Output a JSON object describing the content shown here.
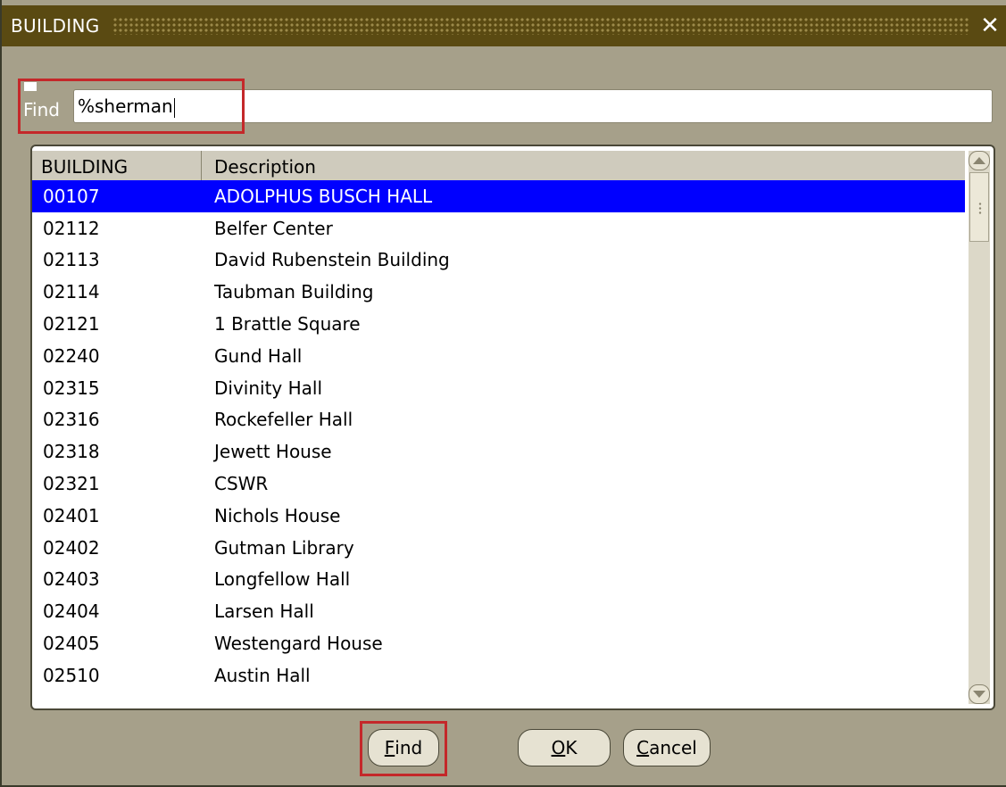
{
  "window": {
    "title": "BUILDING",
    "close_glyph": "✕"
  },
  "find": {
    "label": "Find",
    "value": "%sherman"
  },
  "list": {
    "headers": {
      "code": "BUILDING",
      "description": "Description"
    },
    "rows": [
      {
        "code": "00107",
        "description": "ADOLPHUS BUSCH HALL",
        "selected": true
      },
      {
        "code": "02112",
        "description": "Belfer Center"
      },
      {
        "code": "02113",
        "description": "David Rubenstein Building"
      },
      {
        "code": "02114",
        "description": "Taubman Building"
      },
      {
        "code": "02121",
        "description": "1 Brattle Square"
      },
      {
        "code": "02240",
        "description": "Gund Hall"
      },
      {
        "code": "02315",
        "description": "Divinity Hall"
      },
      {
        "code": "02316",
        "description": "Rockefeller Hall"
      },
      {
        "code": "02318",
        "description": "Jewett House"
      },
      {
        "code": "02321",
        "description": "CSWR"
      },
      {
        "code": "02401",
        "description": "Nichols House"
      },
      {
        "code": "02402",
        "description": "Gutman Library"
      },
      {
        "code": "02403",
        "description": "Longfellow Hall"
      },
      {
        "code": "02404",
        "description": "Larsen Hall"
      },
      {
        "code": "02405",
        "description": "Westengard House"
      },
      {
        "code": "02510",
        "description": "Austin Hall"
      }
    ]
  },
  "buttons": {
    "find": {
      "mnemonic": "F",
      "rest": "ind"
    },
    "ok": {
      "mnemonic": "O",
      "rest": "K"
    },
    "cancel": {
      "mnemonic": "C",
      "rest": "ancel"
    }
  },
  "colors": {
    "titlebar": "#5a4a12",
    "window_bg": "#a6a08a",
    "selection": "#0000ff",
    "highlight_annotation": "#c4282a"
  }
}
